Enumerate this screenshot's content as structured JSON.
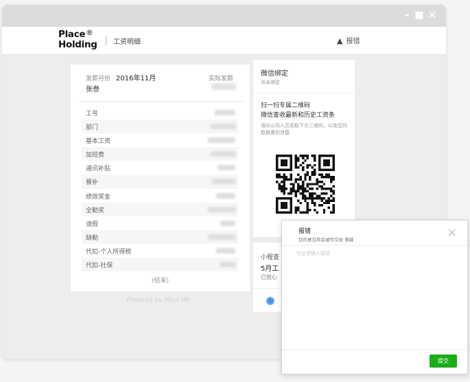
{
  "app": {
    "logo_line1": "Place",
    "logo_line2": "Holding",
    "logo_mark": "®",
    "page_title": "工资明细",
    "report_label": "报错",
    "icons": [
      "minimize-icon",
      "maximize-icon",
      "close-icon",
      "warning-icon"
    ]
  },
  "payslip": {
    "month_label": "发薪月份",
    "month_value": "2016年11月",
    "employee_name": "张叁",
    "net_pay_label": "实际发薪",
    "items": [
      {
        "label": "工号"
      },
      {
        "label": "部门"
      },
      {
        "label": "基本工资"
      },
      {
        "label": "加班费"
      },
      {
        "label": "通讯补贴"
      },
      {
        "label": "餐补"
      },
      {
        "label": "绩效奖金"
      },
      {
        "label": "全勤奖"
      },
      {
        "label": "请假"
      },
      {
        "label": "缺勤"
      },
      {
        "label": "代扣-个人所得税"
      },
      {
        "label": "代扣-社保"
      }
    ],
    "end_label": "(结束)",
    "powered_by": "Powered by Moui HR"
  },
  "wechat": {
    "title": "微信绑定",
    "status": "尚未绑定",
    "line1": "扫一扫专属二维码",
    "line2": "微信查收最新和历史工资条",
    "desc": "请向公司人员索取下方二维码，以免您的数据遭到泄露"
  },
  "mini": {
    "title": "小程查",
    "line1": "5月工",
    "line2": "已放心"
  },
  "dialog": {
    "title": "报错",
    "subtitle": "您的意见将会被传交给 事键",
    "placeholder": "在这里输入报错",
    "submit_label": "提交"
  },
  "colors": {
    "accent_green": "#1aad19",
    "window_bg": "#ededed",
    "titlebar": "#dcdcdc"
  }
}
